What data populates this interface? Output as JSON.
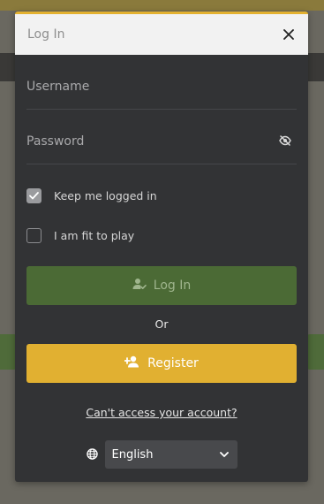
{
  "modal": {
    "title": "Log In",
    "close_icon": "close-icon"
  },
  "form": {
    "username_placeholder": "Username",
    "password_placeholder": "Password",
    "password_toggle_icon": "eye-slash-icon",
    "keep_logged_in": {
      "label": "Keep me logged in",
      "checked": true
    },
    "fit_to_play": {
      "label": "I am fit to play",
      "checked": false
    },
    "login_button": {
      "label": "Log In",
      "icon": "user-check-icon"
    },
    "or_label": "Or",
    "register_button": {
      "label": "Register",
      "icon": "user-plus-icon"
    },
    "forgot_link": "Can't access your account?"
  },
  "language": {
    "icon": "globe-icon",
    "selected": "English"
  },
  "colors": {
    "accent": "#e1b031",
    "login_button": "#4b6a35",
    "modal_bg": "#323335",
    "header_bg": "#f2f2f2"
  }
}
